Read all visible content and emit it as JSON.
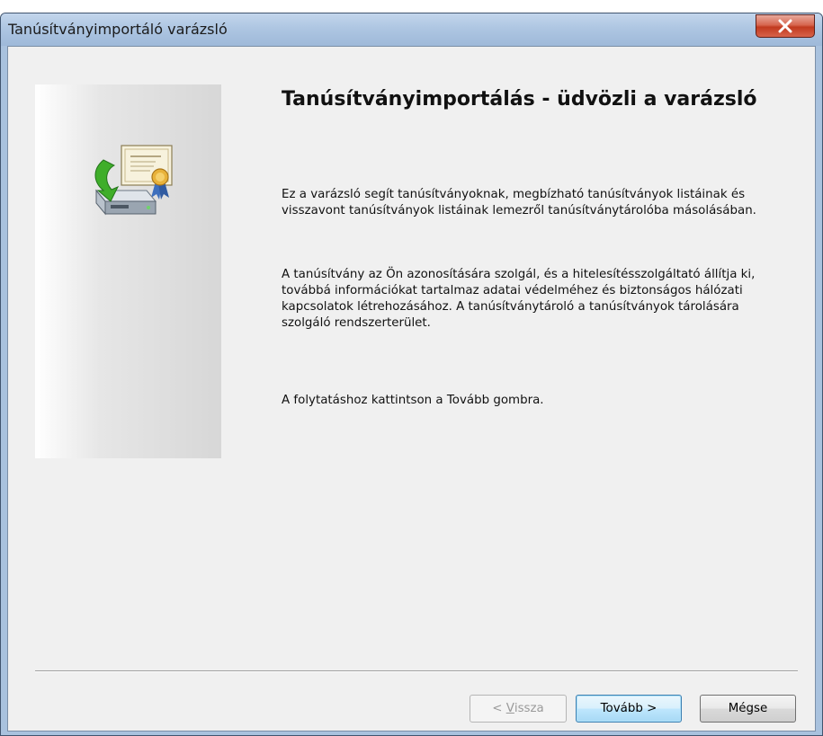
{
  "window": {
    "title": "Tanúsítványimportáló varázsló",
    "close_label": "X"
  },
  "content": {
    "heading": "Tanúsítványimportálás - üdvözli a varázsló",
    "paragraph1": "Ez a varázsló segít tanúsítványoknak, megbízható tanúsítványok listáinak és visszavont tanúsítványok listáinak lemezről tanúsítványtárolóba másolásában.",
    "paragraph2": "A tanúsítvány az Ön azonosítására szolgál, és a hitelesítésszolgáltató állítja ki, továbbá információkat tartalmaz adatai védelméhez és biztonságos hálózati kapcsolatok létrehozásához. A tanúsítványtároló a tanúsítványok tárolására szolgáló rendszerterület.",
    "paragraph3": "A folytatáshoz kattintson a Tovább gombra."
  },
  "buttons": {
    "back_prefix": "< ",
    "back_access_key": "V",
    "back_rest": "issza",
    "next": "Tovább >",
    "cancel": "Mégse"
  },
  "icons": {
    "wizard_icon": "certificate-import-icon",
    "close_icon": "close-icon"
  },
  "colors": {
    "titlebar": "#aec6e2",
    "close_button": "#c13a1f",
    "dialog_background": "#f0f0f0",
    "default_button_border": "#3c7fb1"
  },
  "state": {
    "back_enabled": false
  }
}
